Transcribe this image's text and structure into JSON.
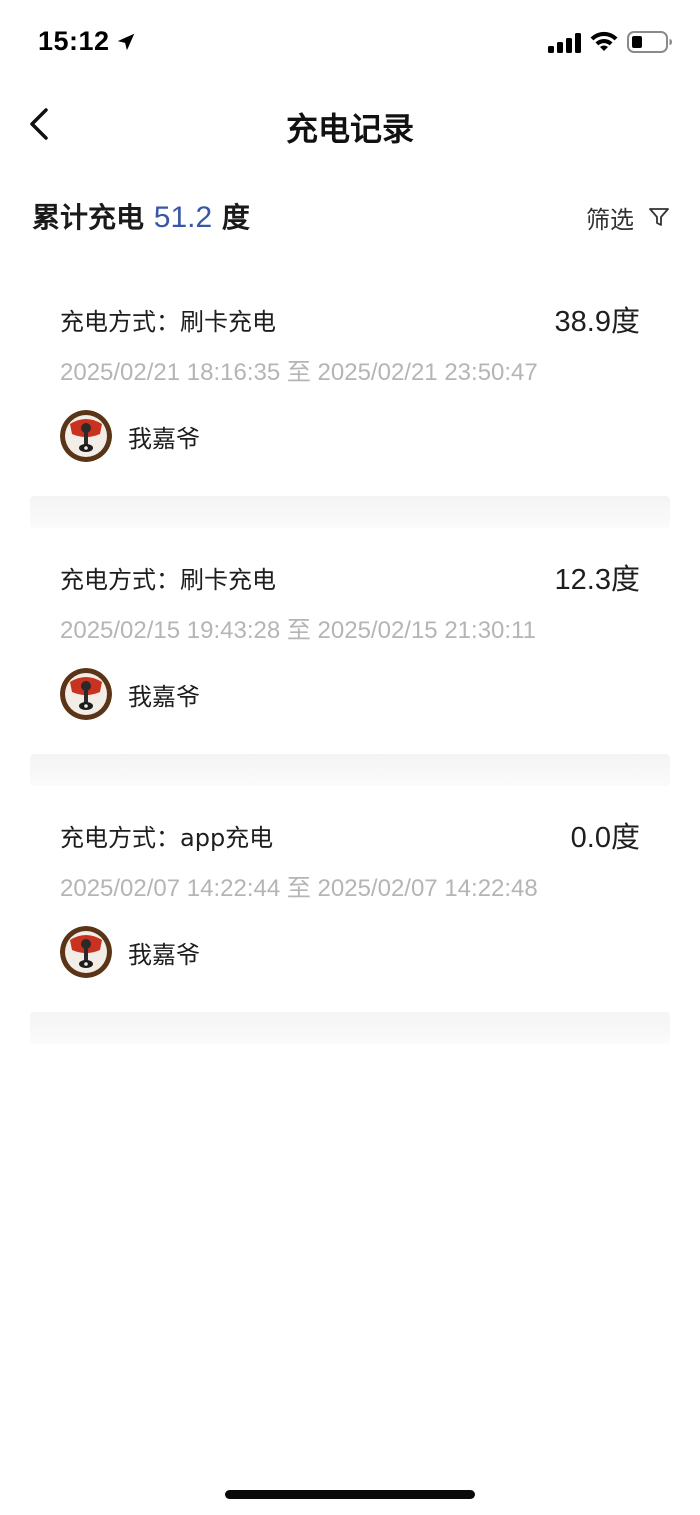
{
  "status_bar": {
    "time": "15:12",
    "icons": [
      "location-arrow-icon",
      "cellular-signal-icon",
      "wifi-icon",
      "battery-icon"
    ]
  },
  "nav": {
    "title": "充电记录",
    "back_icon": "chevron-left-icon"
  },
  "summary": {
    "prefix": "累计充电",
    "value": "51.2",
    "unit": "度",
    "filter_label": "筛选",
    "filter_icon": "funnel-icon",
    "accent_color": "#3a56a6"
  },
  "records": [
    {
      "method": "充电方式：刷卡充电",
      "amount": "38.9度",
      "time_range": "2025/02/21 18:16:35 至 2025/02/21 23:50:47",
      "user": "我嘉爷"
    },
    {
      "method": "充电方式：刷卡充电",
      "amount": "12.3度",
      "time_range": "2025/02/15 19:43:28 至 2025/02/15 21:30:11",
      "user": "我嘉爷"
    },
    {
      "method": "充电方式：app充电",
      "amount": "0.0度",
      "time_range": "2025/02/07 14:22:44 至 2025/02/07 14:22:48",
      "user": "我嘉爷"
    }
  ]
}
